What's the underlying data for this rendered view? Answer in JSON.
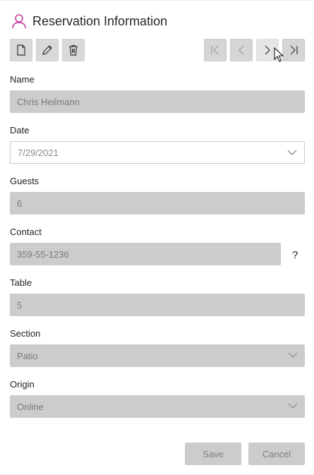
{
  "header": {
    "title": "Reservation Information",
    "icon": "user-icon",
    "accent": "#c2379f"
  },
  "toolbar": {
    "new_icon": "new-document-icon",
    "edit_icon": "pencil-icon",
    "delete_icon": "trash-icon"
  },
  "navigation": {
    "first_icon": "first-record-icon",
    "prev_icon": "previous-record-icon",
    "next_icon": "next-record-icon",
    "last_icon": "last-record-icon"
  },
  "form": {
    "name": {
      "label": "Name",
      "value": "Chris Heilmann"
    },
    "date": {
      "label": "Date",
      "value": "7/29/2021"
    },
    "guests": {
      "label": "Guests",
      "value": "6"
    },
    "contact": {
      "label": "Contact",
      "value": "359-55-1236",
      "help": "?"
    },
    "table": {
      "label": "Table",
      "value": "5"
    },
    "section": {
      "label": "Section",
      "value": "Patio"
    },
    "origin": {
      "label": "Origin",
      "value": "Online"
    }
  },
  "footer": {
    "save_label": "Save",
    "cancel_label": "Cancel"
  }
}
